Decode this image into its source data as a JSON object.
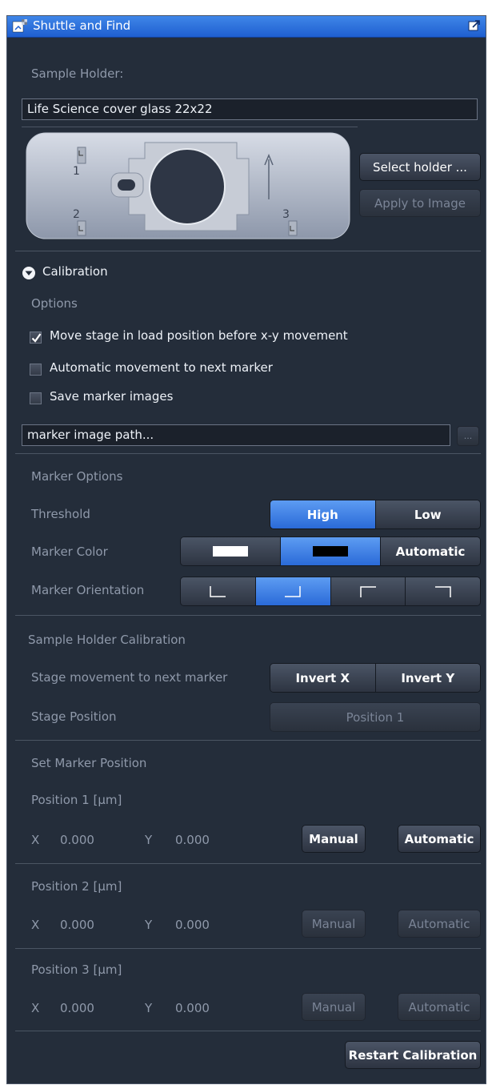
{
  "window": {
    "title": "Shuttle and Find"
  },
  "sample_holder": {
    "label": "Sample Holder:",
    "value": "Life Science cover glass 22x22",
    "marker_labels": [
      "1",
      "2",
      "3"
    ],
    "select_button": "Select holder ...",
    "apply_button": "Apply to Image"
  },
  "calibration": {
    "header": "Calibration",
    "options_label": "Options",
    "checkboxes": [
      {
        "label": "Move stage in load position before x-y movement",
        "checked": true
      },
      {
        "label": "Automatic movement to next marker",
        "checked": false
      },
      {
        "label": "Save marker images",
        "checked": false
      }
    ],
    "path_placeholder": "marker image path...",
    "browse_label": "..."
  },
  "marker_options": {
    "header": "Marker Options",
    "threshold_label": "Threshold",
    "threshold_options": [
      "High",
      "Low"
    ],
    "threshold_selected": "High",
    "color_label": "Marker Color",
    "color_options": [
      "white",
      "black",
      "Automatic"
    ],
    "color_automatic_label": "Automatic",
    "color_selected": "black",
    "orientation_label": "Marker Orientation",
    "orientation_selected": 1
  },
  "holder_calibration": {
    "header": "Sample Holder Calibration",
    "movement_label": "Stage movement to next marker",
    "invert_x": "Invert X",
    "invert_y": "Invert Y",
    "stage_position_label": "Stage Position",
    "stage_position_value": "Position 1"
  },
  "set_marker_position": {
    "header": "Set Marker Position",
    "positions": [
      {
        "title": "Position 1 [µm]",
        "x_label": "X",
        "x": "0.000",
        "y_label": "Y",
        "y": "0.000",
        "manual": "Manual",
        "automatic": "Automatic",
        "enabled": true
      },
      {
        "title": "Position 2 [µm]",
        "x_label": "X",
        "x": "0.000",
        "y_label": "Y",
        "y": "0.000",
        "manual": "Manual",
        "automatic": "Automatic",
        "enabled": false
      },
      {
        "title": "Position 3 [µm]",
        "x_label": "X",
        "x": "0.000",
        "y_label": "Y",
        "y": "0.000",
        "manual": "Manual",
        "automatic": "Automatic",
        "enabled": false
      }
    ],
    "restart_button": "Restart Calibration"
  },
  "colors": {
    "accent": "#2a6ad8",
    "panel_bg": "#242d3a",
    "titlebar": "#2d6fdc"
  }
}
